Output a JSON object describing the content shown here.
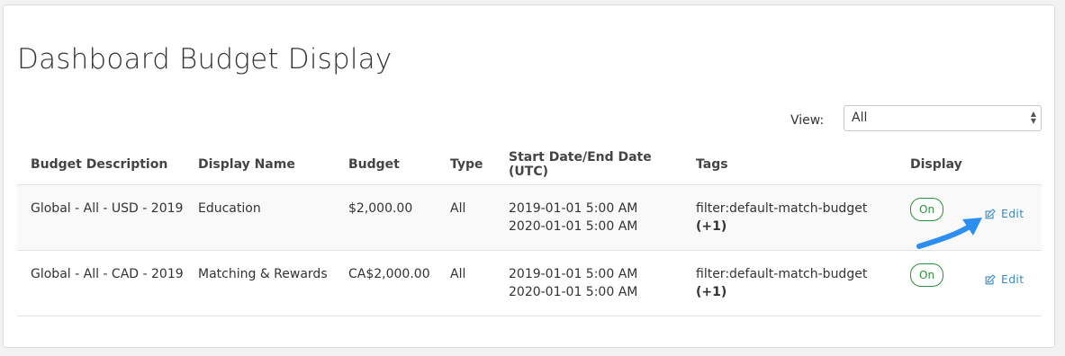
{
  "page": {
    "title": "Dashboard Budget Display"
  },
  "filter": {
    "label": "View:",
    "selected": "All"
  },
  "table": {
    "headers": [
      "Budget Description",
      "Display Name",
      "Budget",
      "Type",
      "Start Date/End Date (UTC)",
      "Tags",
      "Display"
    ],
    "rows": [
      {
        "description": "Global - All - USD - 2019",
        "display_name": "Education",
        "budget": "$2,000.00",
        "type": "All",
        "start_date": "2019-01-01 5:00 AM",
        "end_date": "2020-01-01 5:00 AM",
        "tag": "filter:default-match-budget",
        "tag_more": "(+1)",
        "display": "On",
        "edit": "Edit"
      },
      {
        "description": "Global - All - CAD - 2019",
        "display_name": "Matching & Rewards",
        "budget": "CA$2,000.00",
        "type": "All",
        "start_date": "2019-01-01 5:00 AM",
        "end_date": "2020-01-01 5:00 AM",
        "tag": "filter:default-match-budget",
        "tag_more": "(+1)",
        "display": "On",
        "edit": "Edit"
      }
    ]
  },
  "colors": {
    "accent": "#3a8bc6",
    "toggle": "#2e8b3e",
    "arrow": "#2b8ef0"
  },
  "icons": {
    "edit": "edit-icon",
    "annotation": "arrow-annotation"
  }
}
